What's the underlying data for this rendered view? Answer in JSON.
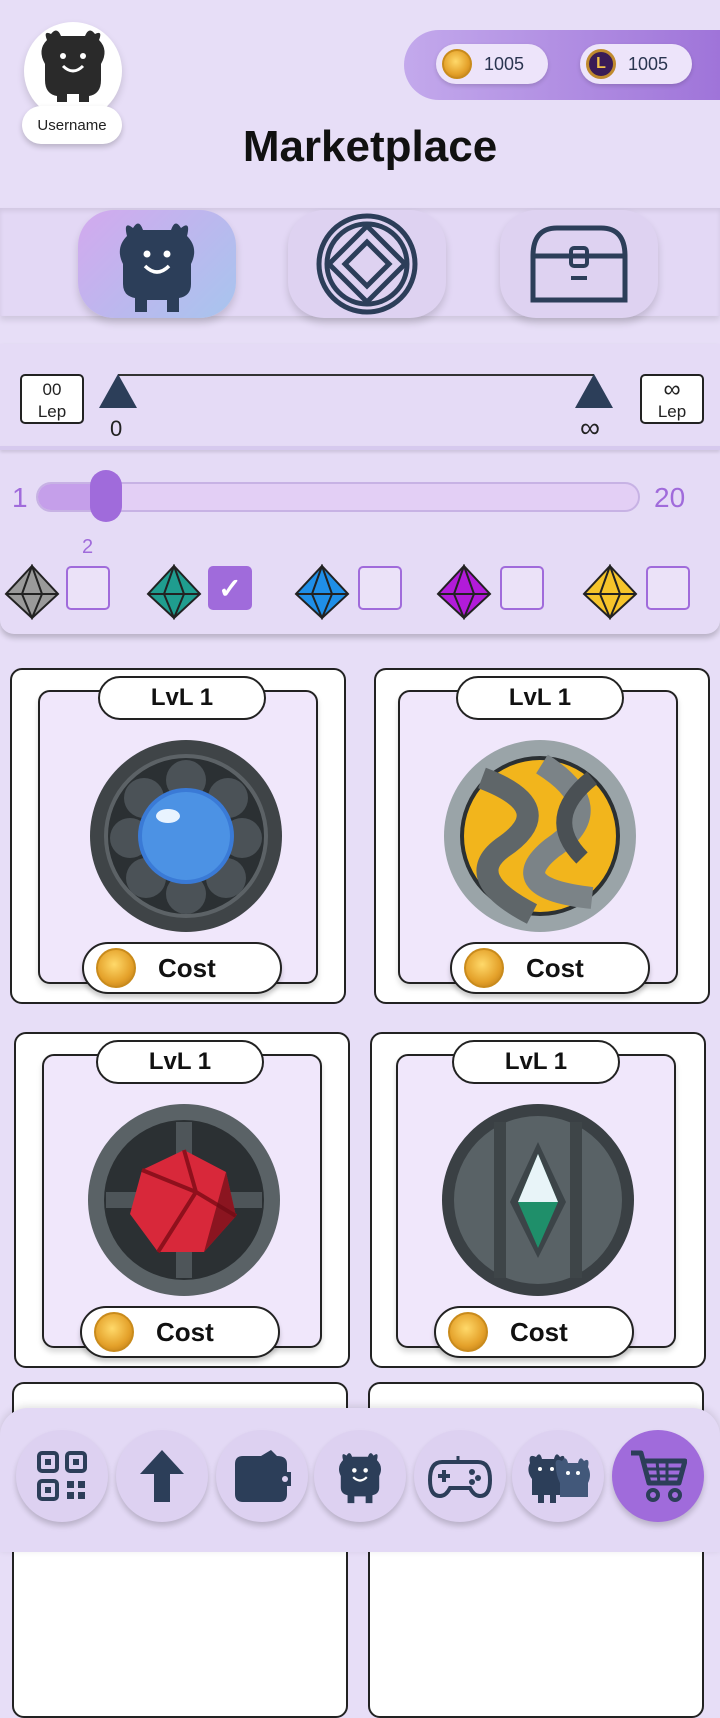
{
  "header": {
    "username": "Username",
    "title": "Marketplace",
    "coins": "1005",
    "lep": "1005",
    "lep_icon_letter": "L"
  },
  "categories": [
    {
      "name": "monsters",
      "icon": "monster-icon",
      "active": true
    },
    {
      "name": "gems",
      "icon": "diamond-emblem-icon",
      "active": false
    },
    {
      "name": "chests",
      "icon": "treasure-chest-icon",
      "active": false
    }
  ],
  "price_filter": {
    "min_box": {
      "value": "00",
      "unit": "Lep"
    },
    "max_box": {
      "value": "∞",
      "unit": "Lep"
    },
    "min_label": "0",
    "max_label": "∞"
  },
  "level_filter": {
    "min": "1",
    "max": "20",
    "current": "2"
  },
  "rarity_filters": [
    {
      "name": "gray",
      "color": "#8c8c8c",
      "checked": false
    },
    {
      "name": "teal",
      "color": "#1f9d8f",
      "checked": true,
      "check_mark": "✓"
    },
    {
      "name": "blue",
      "color": "#1f8fe8",
      "checked": false
    },
    {
      "name": "purple",
      "color": "#b21bd9",
      "checked": false
    },
    {
      "name": "yellow",
      "color": "#f6c42a",
      "checked": false
    }
  ],
  "items": [
    {
      "level": "LvL 1",
      "cost_label": "Cost",
      "art": "blue-orb-icon"
    },
    {
      "level": "LvL 1",
      "cost_label": "Cost",
      "art": "yellow-twisted-orb-icon"
    },
    {
      "level": "LvL 1",
      "cost_label": "Cost",
      "art": "red-gem-icon"
    },
    {
      "level": "LvL 1",
      "cost_label": "Cost",
      "art": "green-crystal-icon"
    }
  ],
  "bottom_nav": [
    {
      "name": "qr-code-icon"
    },
    {
      "name": "upload-arrow-icon"
    },
    {
      "name": "wallet-icon"
    },
    {
      "name": "monster-icon"
    },
    {
      "name": "gamepad-icon"
    },
    {
      "name": "friends-icon"
    },
    {
      "name": "cart-icon",
      "active": true
    }
  ],
  "colors": {
    "accent": "#a06bdb",
    "navy": "#2c3e59",
    "background": "#e7def7"
  }
}
